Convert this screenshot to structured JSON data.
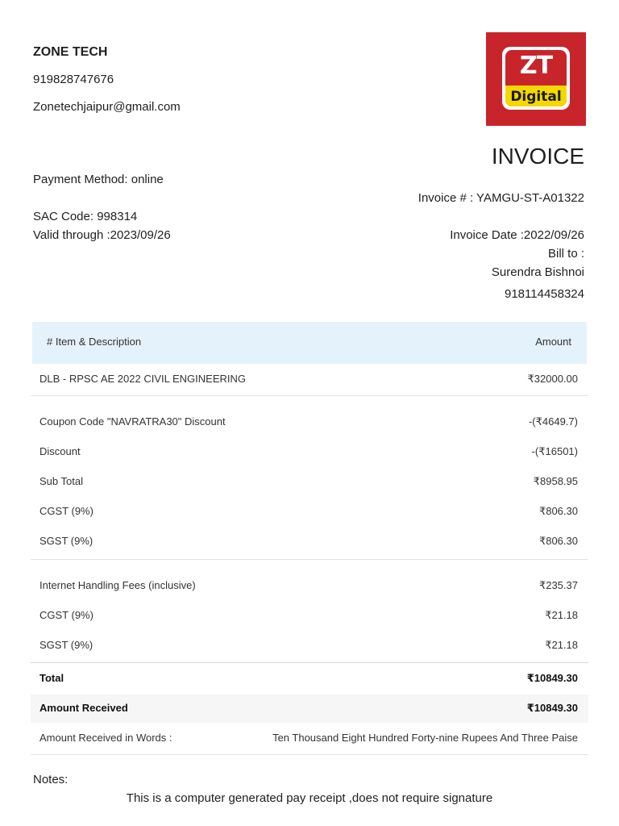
{
  "company": {
    "name": "ZONE TECH",
    "phone": "919828747676",
    "email": "Zonetechjaipur@gmail.com",
    "logo_top": "ZT",
    "logo_bottom": "Digital"
  },
  "invoice": {
    "title": "INVOICE",
    "number": "Invoice # : YAMGU-ST-A01322",
    "date": "Invoice Date :2022/09/26",
    "bill_to_label": "Bill to :",
    "customer_name": "Surendra Bishnoi",
    "customer_phone": "918114458324"
  },
  "details": {
    "payment_method": "Payment Method: online",
    "sac_code": "SAC Code: 998314",
    "valid_through": "Valid through :2023/09/26"
  },
  "table": {
    "header_item": "# Item & Description",
    "header_amount": "Amount",
    "item": {
      "label": "DLB - RPSC AE 2022 CIVIL ENGINEERING",
      "amount": "₹32000.00"
    },
    "coupon": {
      "label": "Coupon Code \"NAVRATRA30\" Discount",
      "amount": "-(₹4649.7)"
    },
    "discount": {
      "label": "Discount",
      "amount": "-(₹16501)"
    },
    "subtotal": {
      "label": "Sub Total",
      "amount": "₹8958.95"
    },
    "cgst1": {
      "label": "CGST (9%)",
      "amount": "₹806.30"
    },
    "sgst1": {
      "label": "SGST (9%)",
      "amount": "₹806.30"
    },
    "handling": {
      "label": "Internet Handling Fees (inclusive)",
      "amount": "₹235.37"
    },
    "cgst2": {
      "label": "CGST (9%)",
      "amount": "₹21.18"
    },
    "sgst2": {
      "label": "SGST (9%)",
      "amount": "₹21.18"
    },
    "total": {
      "label": "Total",
      "amount": "₹10849.30"
    },
    "received": {
      "label": "Amount Received",
      "amount": "₹10849.30"
    },
    "words": {
      "label": "Amount Received in Words :",
      "value": "Ten Thousand Eight Hundred Forty-nine Rupees And Three Paise"
    }
  },
  "notes": {
    "label": "Notes:",
    "text": "This is a computer generated pay receipt ,does not require signature"
  },
  "colors": {
    "logo_red": "#c7252b",
    "logo_yellow": "#f5d800",
    "table_header_bg": "#e4f2fb"
  }
}
